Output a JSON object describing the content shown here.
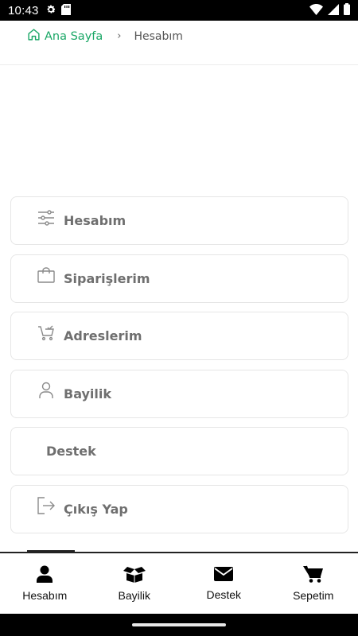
{
  "status_bar": {
    "time": "10:43",
    "icons_left": [
      "gear-icon",
      "sd-card-icon"
    ],
    "icons_right": [
      "wifi-icon",
      "signal-icon",
      "battery-icon"
    ]
  },
  "breadcrumb": {
    "home_label": "Ana Sayfa",
    "separator": "›",
    "current": "Hesabım",
    "accent_color": "#1aa766"
  },
  "menu": {
    "items": [
      {
        "label": "Hesabım",
        "icon": "sliders-icon"
      },
      {
        "label": "Siparişlerim",
        "icon": "shopping-bag-icon"
      },
      {
        "label": "Adreslerim",
        "icon": "cart-check-icon"
      },
      {
        "label": "Bayilik",
        "icon": "user-icon"
      },
      {
        "label": "Destek",
        "icon": ""
      },
      {
        "label": "Çıkış Yap",
        "icon": "logout-icon"
      }
    ]
  },
  "bottom_nav": {
    "items": [
      {
        "label": "Hesabım",
        "icon": "user-solid-icon"
      },
      {
        "label": "Bayilik",
        "icon": "box-open-icon"
      },
      {
        "label": "Destek",
        "icon": "envelope-icon"
      },
      {
        "label": "Sepetim",
        "icon": "cart-icon"
      }
    ]
  }
}
